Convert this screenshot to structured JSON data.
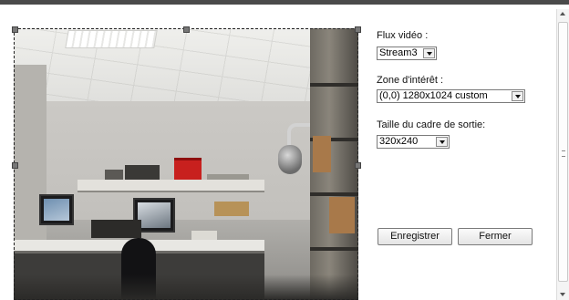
{
  "flux_video": {
    "label": "Flux vidéo :",
    "selected": "Stream3"
  },
  "zone_interet": {
    "label": "Zone d'intérêt :",
    "selected": "(0,0) 1280x1024 custom"
  },
  "taille_cadre": {
    "label": "Taille du cadre de sortie:",
    "selected": "320x240"
  },
  "buttons": {
    "save": "Enregistrer",
    "close": "Fermer"
  },
  "icons": {
    "dropdown": "chevron-down-icon",
    "scroll_up": "arrow-up-icon",
    "scroll_down": "arrow-down-icon"
  },
  "colors": {
    "top_bar": "#4a4a4a",
    "frame": "#222222"
  }
}
